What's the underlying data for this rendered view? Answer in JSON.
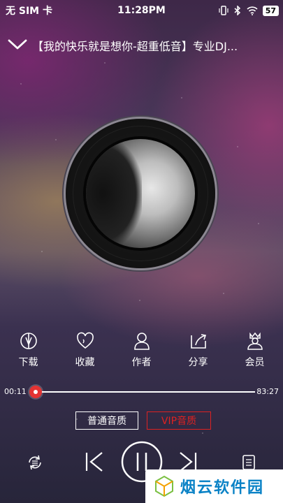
{
  "status_bar": {
    "carrier": "无 SIM 卡",
    "time": "11:28PM",
    "battery": "57"
  },
  "header": {
    "title": "【我的快乐就是想你-超重低音】专业DJ..."
  },
  "actions": [
    {
      "label": "下载",
      "icon": "download-icon"
    },
    {
      "label": "收藏",
      "icon": "heart-icon"
    },
    {
      "label": "作者",
      "icon": "user-icon"
    },
    {
      "label": "分享",
      "icon": "share-icon"
    },
    {
      "label": "会员",
      "icon": "crown-icon"
    }
  ],
  "progress": {
    "current": "00:11",
    "total": "83:27",
    "fraction": 0.002
  },
  "quality": {
    "standard": "普通音质",
    "vip": "VIP音质"
  },
  "watermark": {
    "text": "烟云软件园"
  },
  "colors": {
    "accent": "#e43333"
  }
}
